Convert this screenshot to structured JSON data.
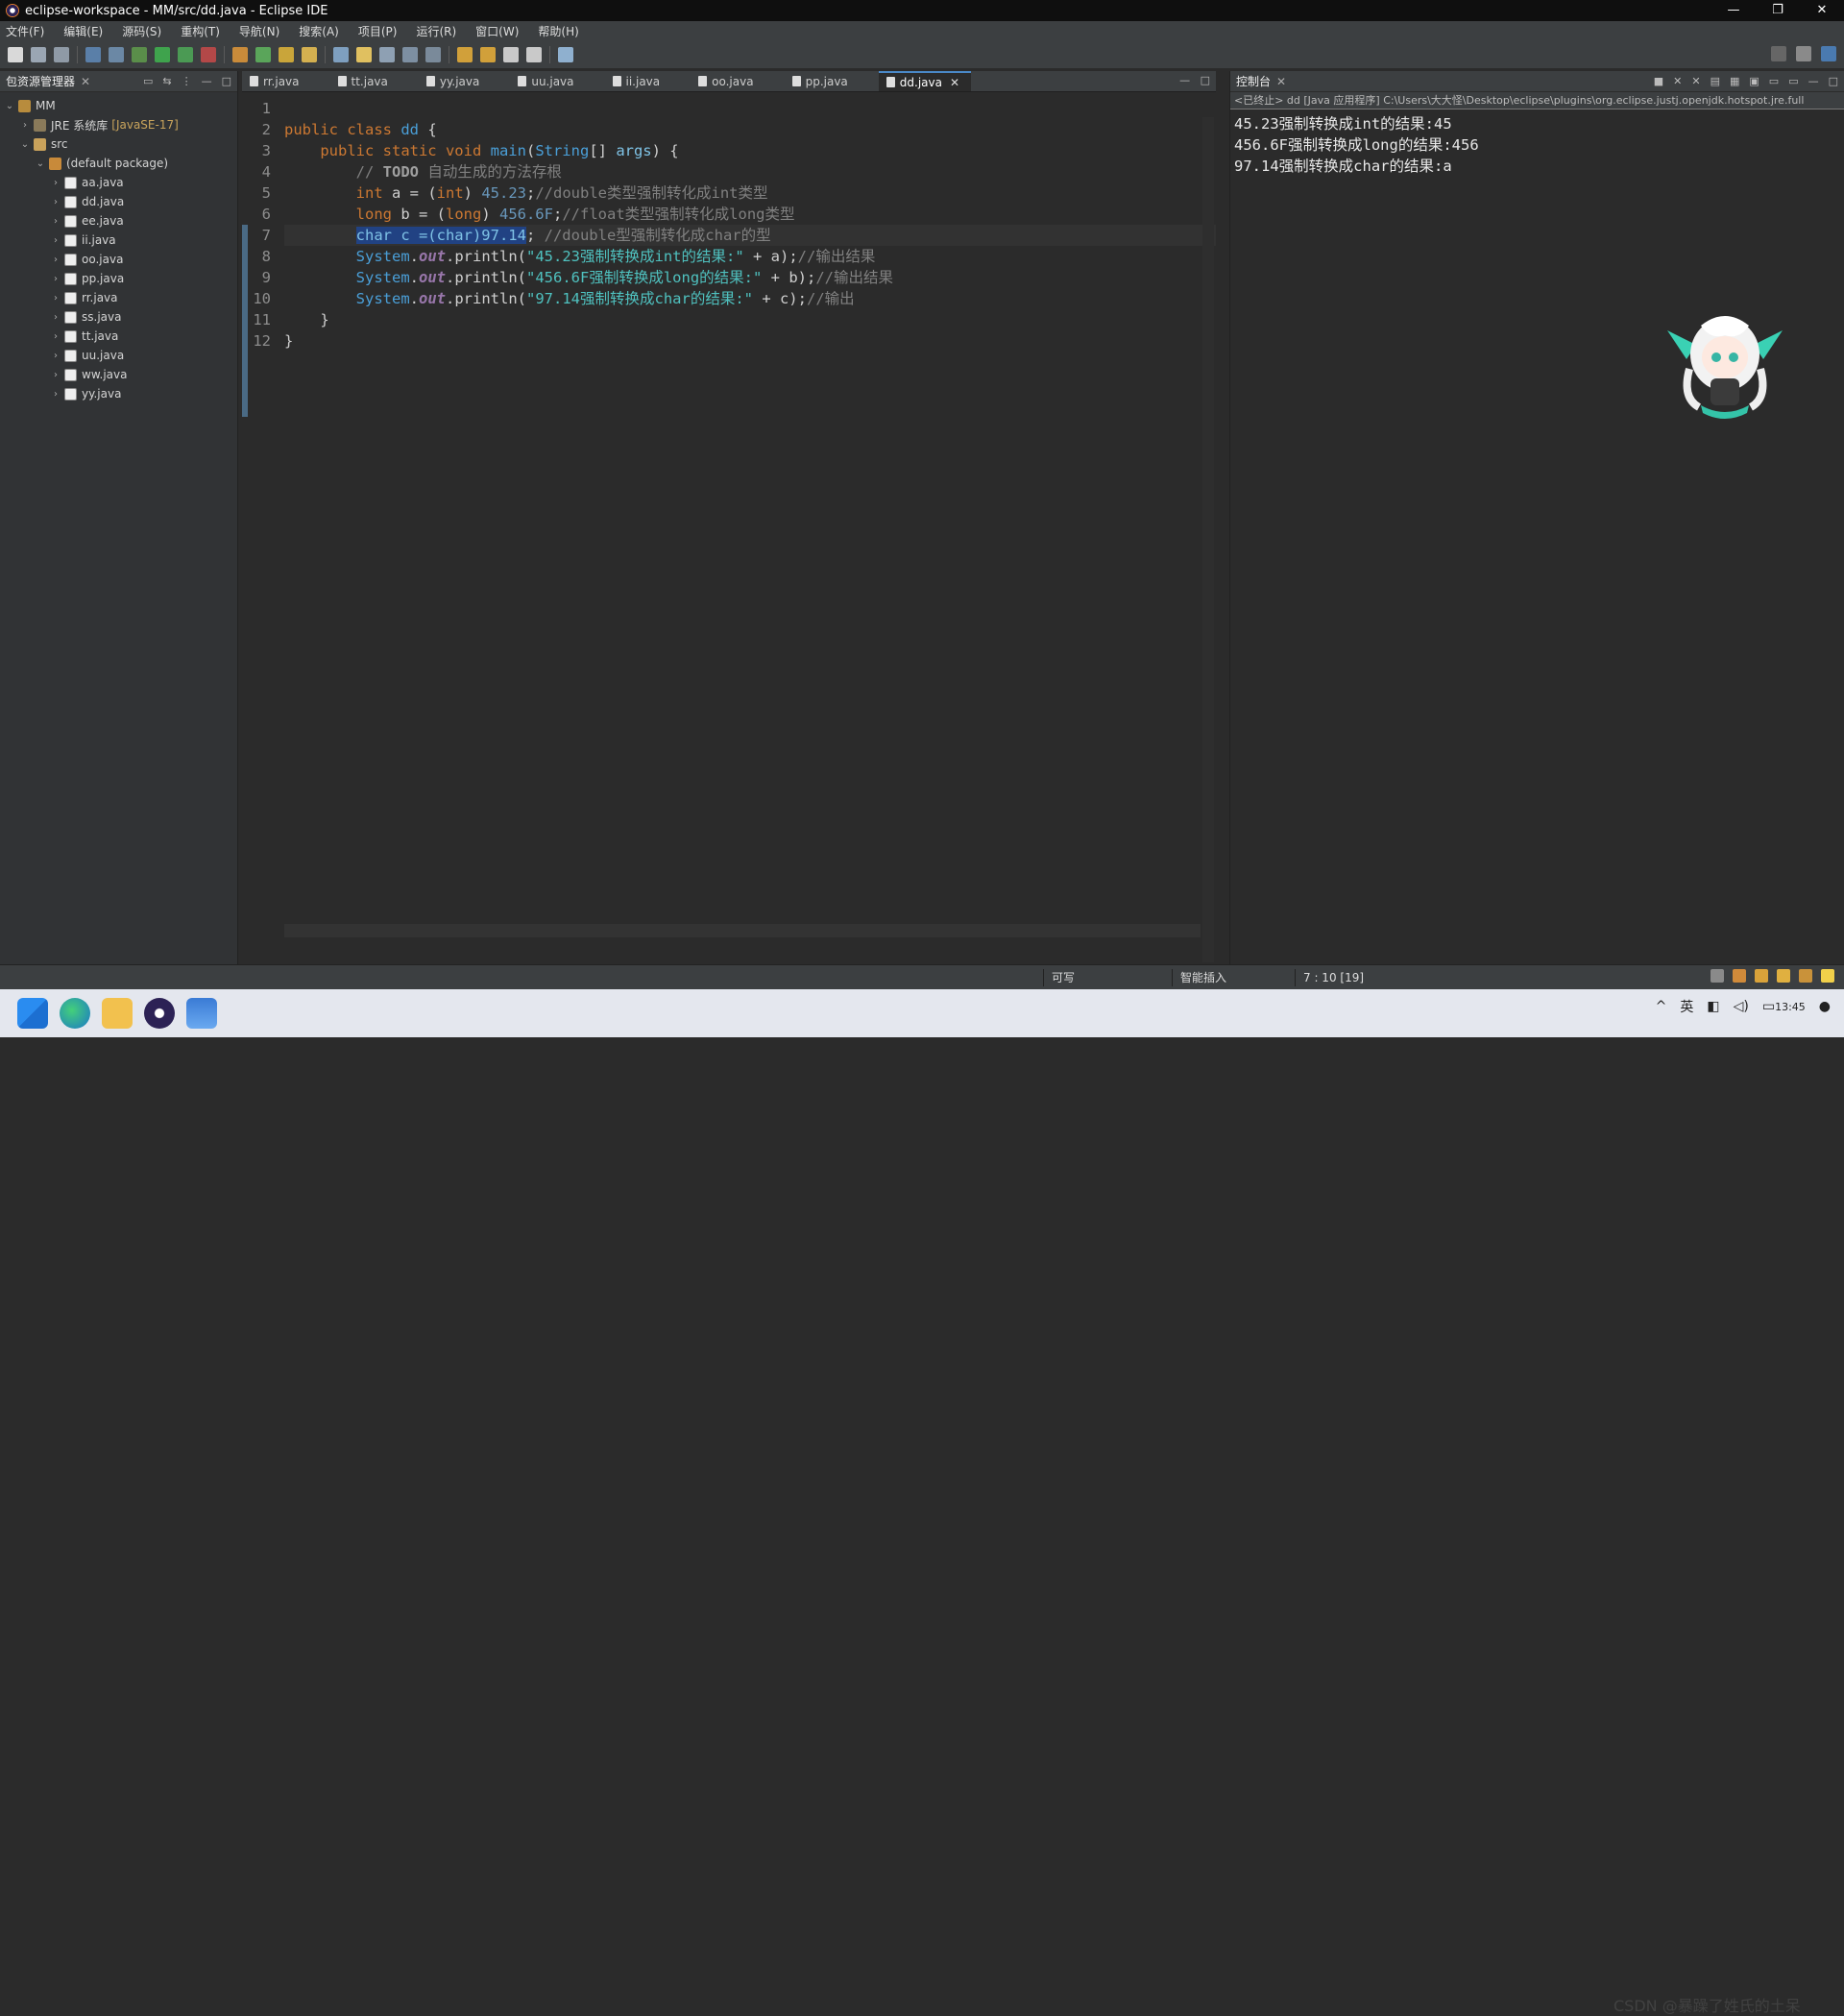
{
  "window": {
    "title": "eclipse-workspace - MM/src/dd.java - Eclipse IDE",
    "controls": [
      "—",
      "❐",
      "✕"
    ]
  },
  "menu": [
    "文件(F)",
    "编辑(E)",
    "源码(S)",
    "重构(T)",
    "导航(N)",
    "搜索(A)",
    "项目(P)",
    "运行(R)",
    "窗口(W)",
    "帮助(H)"
  ],
  "explorer": {
    "title": "包资源管理器",
    "items": [
      {
        "label": "MM",
        "depth": 0,
        "arrow": "⌄",
        "icon": "project-icon"
      },
      {
        "label": "JRE 系统库",
        "extra": "[JavaSE-17]",
        "depth": 1,
        "arrow": "›",
        "icon": "library-icon"
      },
      {
        "label": "src",
        "depth": 1,
        "arrow": "⌄",
        "icon": "source-folder-icon"
      },
      {
        "label": "(default package)",
        "depth": 2,
        "arrow": "⌄",
        "icon": "package-icon"
      },
      {
        "label": "aa.java",
        "depth": 3,
        "arrow": "›",
        "icon": "java-file-icon"
      },
      {
        "label": "dd.java",
        "depth": 3,
        "arrow": "›",
        "icon": "java-file-icon"
      },
      {
        "label": "ee.java",
        "depth": 3,
        "arrow": "›",
        "icon": "java-file-icon"
      },
      {
        "label": "ii.java",
        "depth": 3,
        "arrow": "›",
        "icon": "java-file-icon"
      },
      {
        "label": "oo.java",
        "depth": 3,
        "arrow": "›",
        "icon": "java-file-icon"
      },
      {
        "label": "pp.java",
        "depth": 3,
        "arrow": "›",
        "icon": "java-file-icon"
      },
      {
        "label": "rr.java",
        "depth": 3,
        "arrow": "›",
        "icon": "java-file-icon"
      },
      {
        "label": "ss.java",
        "depth": 3,
        "arrow": "›",
        "icon": "java-file-icon"
      },
      {
        "label": "tt.java",
        "depth": 3,
        "arrow": "›",
        "icon": "java-file-icon"
      },
      {
        "label": "uu.java",
        "depth": 3,
        "arrow": "›",
        "icon": "java-file-icon"
      },
      {
        "label": "ww.java",
        "depth": 3,
        "arrow": "›",
        "icon": "java-file-icon"
      },
      {
        "label": "yy.java",
        "depth": 3,
        "arrow": "›",
        "icon": "java-file-icon"
      }
    ]
  },
  "editor": {
    "tabs": [
      "rr.java",
      "tt.java",
      "yy.java",
      "uu.java",
      "ii.java",
      "oo.java",
      "pp.java",
      "dd.java"
    ],
    "active_tab": "dd.java",
    "current_line": 7,
    "line_numbers": [
      "1",
      "2",
      "3",
      "4",
      "5",
      "6",
      "7",
      "8",
      "9",
      "10",
      "11",
      "12"
    ],
    "code": {
      "l2_kw": "public class ",
      "l2_name": "dd",
      "l2_rest": " {",
      "l3_kw": "    public static void ",
      "l3_fn": "main",
      "l3_p1": "(",
      "l3_type": "String",
      "l3_p2": "[] ",
      "l3_var": "args",
      "l3_p3": ") {",
      "l4_pre": "        // ",
      "l4_todo": "TODO",
      "l4_com": " 自动生成的方法存根",
      "l5_kw": "int",
      "l5_a": " a = (",
      "l5_cast": "int",
      "l5_b": ") ",
      "l5_num": "45.23",
      "l5_c": ";",
      "l5_com": "//double类型强制转化成int类型",
      "l6_kw": "long",
      "l6_a": " b = (",
      "l6_cast": "long",
      "l6_b": ") ",
      "l6_num": "456.6F",
      "l6_c": ";",
      "l6_com": "//float类型强制转化成long类型",
      "l7_sel": "char c =(char)97.14",
      "l7_c": "; ",
      "l7_com": "//double型强制转化成char的型",
      "sys": "System",
      "dot": ".",
      "out": "out",
      "println": ".println(",
      "l8_str": "\"45.23强制转换成int的结果:\"",
      "l8_rest": " + a);",
      "l8_com": "//输出结果",
      "l9_str": "\"456.6F强制转换成long的结果:\"",
      "l9_rest": " + b);",
      "l9_com": "//输出结果",
      "l10_str": "\"97.14强制转换成char的结果:\"",
      "l10_rest": " + c);",
      "l10_com": "//输出",
      "l11": "    }",
      "l12": "}"
    }
  },
  "console": {
    "title": "控制台",
    "path": "<已终止> dd [Java 应用程序] C:\\Users\\大大怪\\Desktop\\eclipse\\plugins\\org.eclipse.justj.openjdk.hotspot.jre.full",
    "output": [
      "45.23强制转换成int的结果:45",
      "456.6F强制转换成long的结果:456",
      "97.14强制转换成char的结果:a"
    ]
  },
  "status": {
    "writable": "可写",
    "insert_mode": "智能插入",
    "position": "7 : 10 [19]"
  },
  "taskbar": {
    "clock_time": "13:45",
    "ime": "英",
    "watermark": "CSDN @暴躁了姓氏的土呆"
  },
  "colors": {
    "accent": "#4a88c7",
    "selection": "#214283",
    "keyword": "#cc7832",
    "string": "#4fc1bf"
  }
}
